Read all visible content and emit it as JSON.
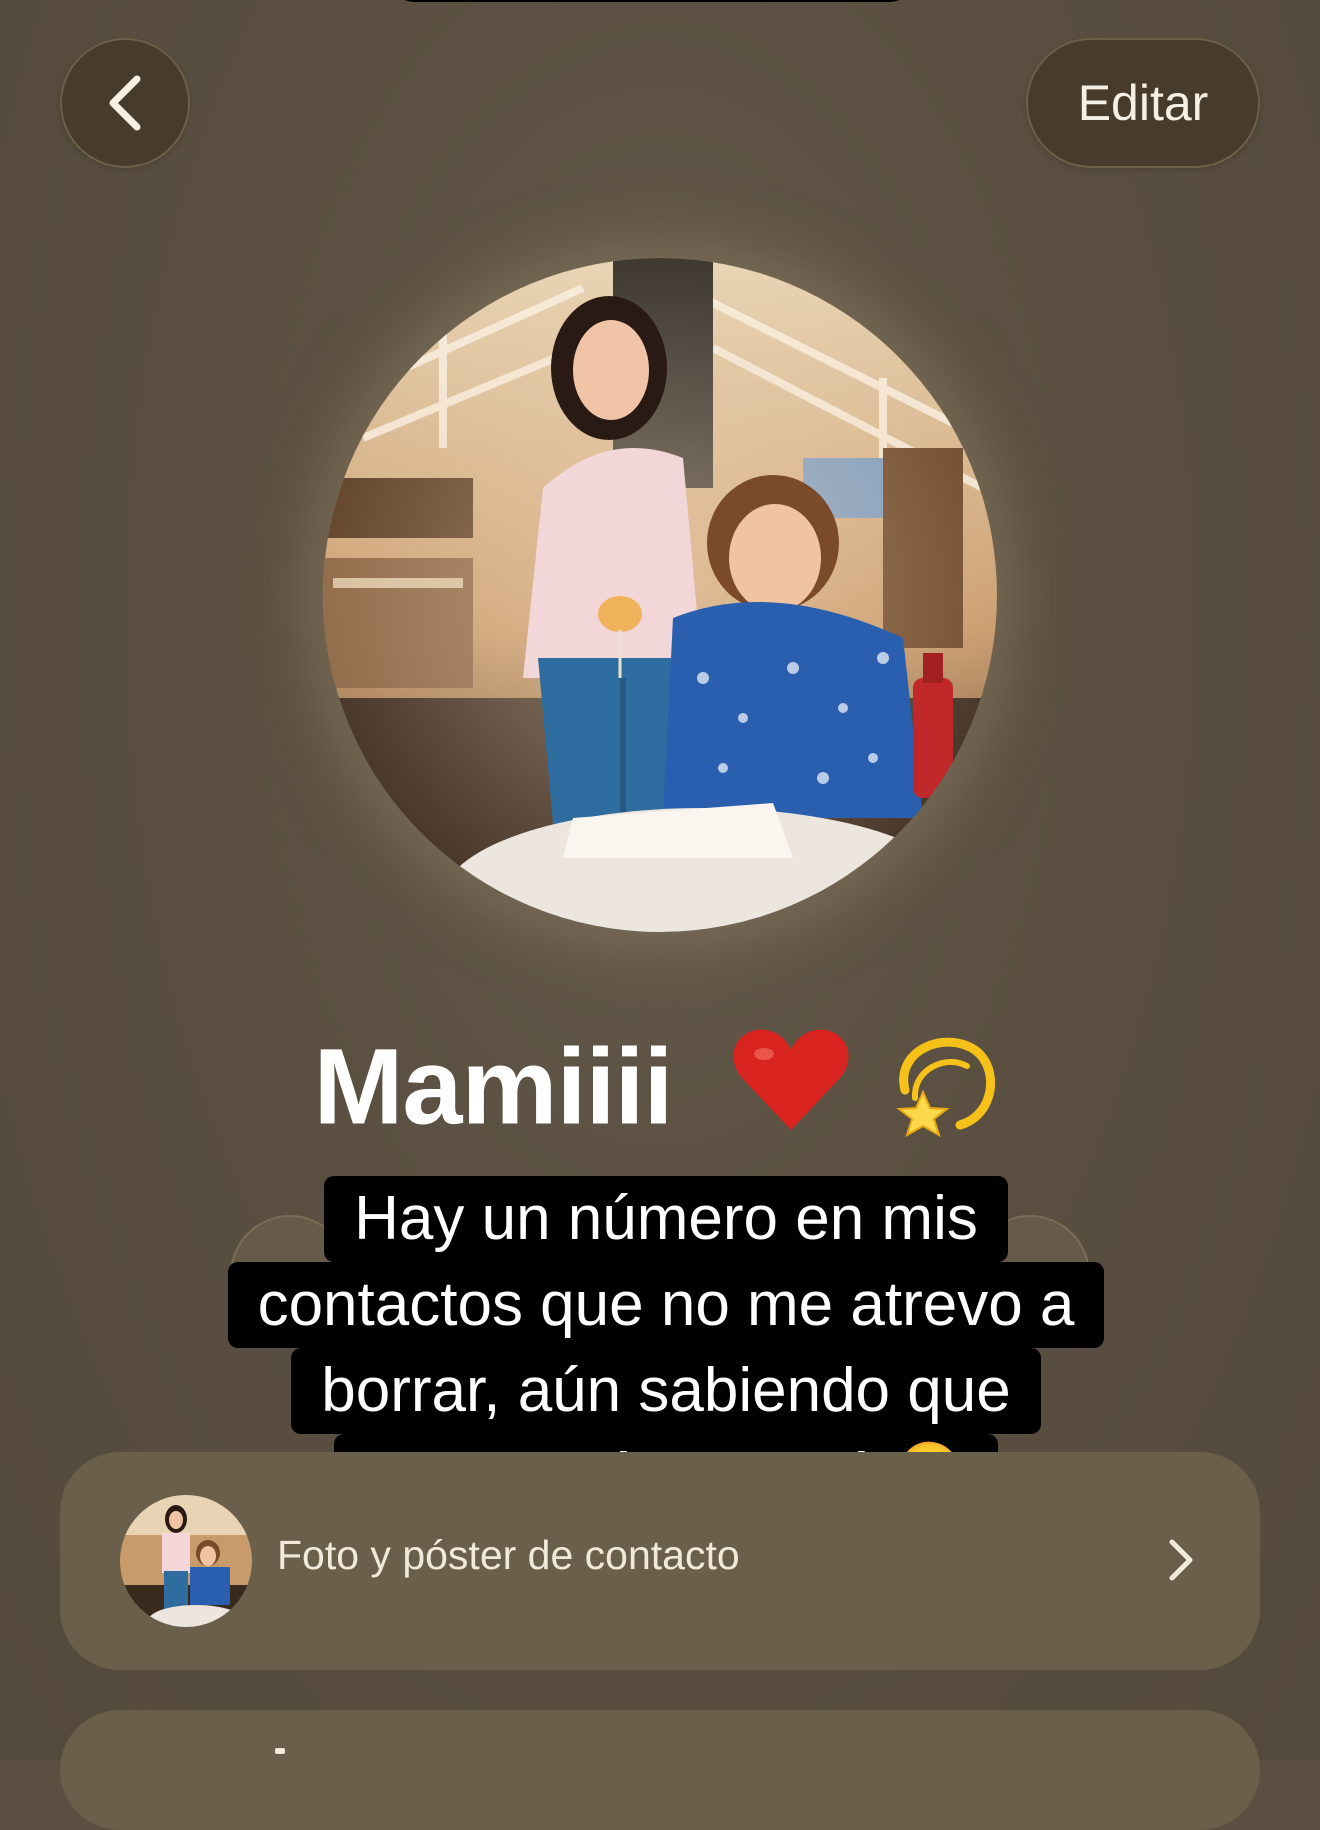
{
  "header": {
    "back_icon": "chevron-left-icon",
    "edit_label": "Editar"
  },
  "contact": {
    "name": "Mamiiii",
    "name_emojis": "♥️💫",
    "photo": "photo-two-women-restaurant"
  },
  "overlay_caption": {
    "lines": [
      "Hay un número en mis",
      "contactos que no me atrevo a",
      "borrar, aún sabiendo que",
      "nunca más sonará 🫠"
    ]
  },
  "settings": {
    "photo_poster_label": "Foto y póster de contacto",
    "chevron_icon": "chevron-right-icon"
  },
  "colors": {
    "background": "#5a4f40",
    "button_bg": "#473c2c",
    "card_bg": "#6a5f4a",
    "heart": "#d8231f"
  }
}
